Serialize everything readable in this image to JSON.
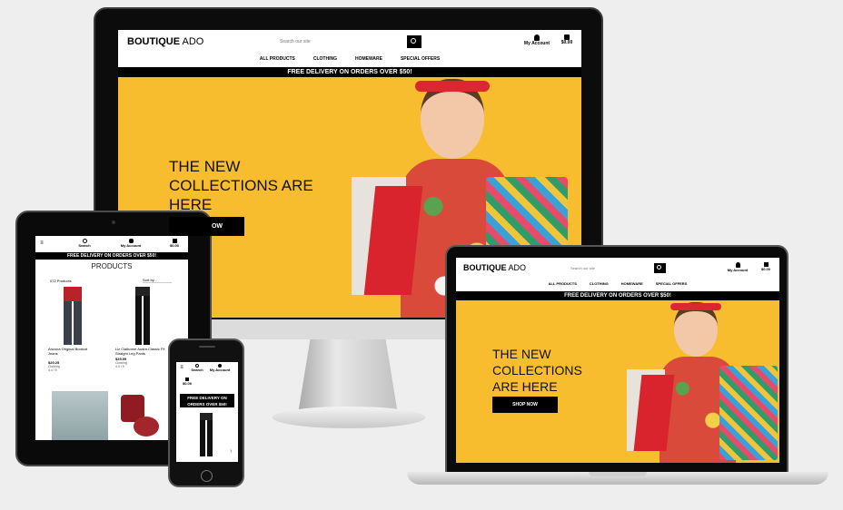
{
  "site": {
    "brand_bold": "BOUTIQUE",
    "brand_light": "ADO",
    "search_placeholder": "Search our site",
    "account_label": "My Account",
    "cart_total": "$0.00",
    "nav": [
      "ALL PRODUCTS",
      "CLOTHING",
      "HOMEWARE",
      "SPECIAL OFFERS"
    ],
    "banner": "FREE DELIVERY ON ORDERS OVER $50!",
    "banner_short": "FREE DELIVERY ON ORDERS OVER $50.",
    "hero_line1": "THE NEW",
    "hero_line2": "COLLECTIONS ARE",
    "hero_line3": "HERE",
    "laptop_line1": "THE NEW",
    "laptop_line2": "COLLECTIONS",
    "laptop_line3": "ARE HERE",
    "shop_now": "SHOP NOW",
    "shop_now_partial": "OW"
  },
  "tablet": {
    "search_label": "Search",
    "account_label": "My Account",
    "cart_total": "$0.00",
    "banner": "FREE DELIVERY ON ORDERS OVER $50!",
    "heading": "PRODUCTS",
    "count": "072 Products",
    "sort": "Sort by...",
    "products": [
      {
        "name": "Arizona Original Bootcut Jeans",
        "price": "$20.25",
        "category": "Clothing",
        "rating": "4.4 / 5"
      },
      {
        "name": "Liz Claiborne Audra Classic Fit Straight Leg Pants",
        "price": "$25.99",
        "category": "Clothing",
        "rating": "4.0 / 5"
      }
    ]
  },
  "phone": {
    "search_label": "Search",
    "account_label": "My Account",
    "cart_total": "$0.00",
    "banner_line1": "FREE DELIVERY ON",
    "banner_line2": "ORDERS OVER $50!"
  },
  "colors": {
    "hero_yellow": "#f8bd2e",
    "dark": "#000000",
    "banner_text": "#ffffff"
  }
}
